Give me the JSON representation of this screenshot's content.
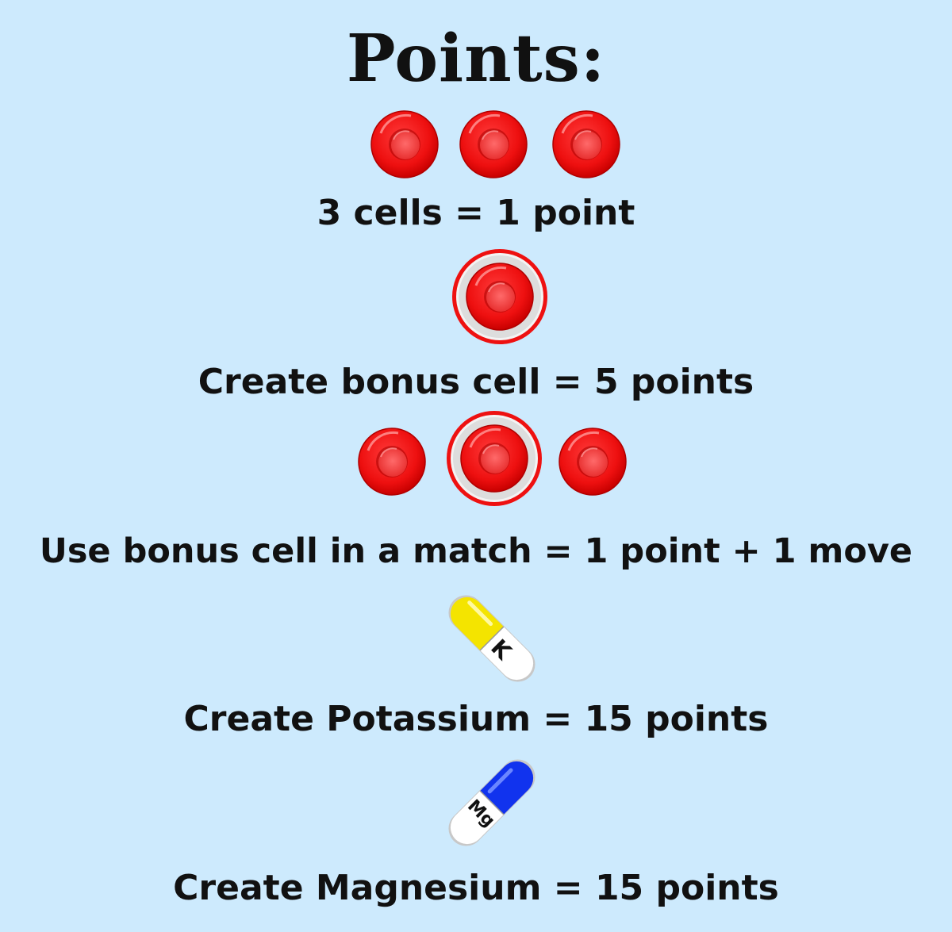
{
  "title": "Points:",
  "rules": [
    {
      "label": "3 cells = 1 point"
    },
    {
      "label": "Create bonus cell = 5 points"
    },
    {
      "label": "Use bonus cell in a match = 1 point + 1 move"
    },
    {
      "label": "Create Potassium = 15 points",
      "pill_letter": "K"
    },
    {
      "label": "Create Magnesium = 15 points",
      "pill_letter": "Mg"
    }
  ],
  "icons": {
    "cell": "red-blood-cell-icon",
    "bonus_cell": "bonus-blood-cell-icon",
    "potassium": "potassium-pill-icon",
    "magnesium": "magnesium-pill-icon"
  },
  "colors": {
    "background": "#cdeafd",
    "cell_red": "#ee1111",
    "potassium_yellow": "#f4e400",
    "magnesium_blue": "#1133ee"
  }
}
